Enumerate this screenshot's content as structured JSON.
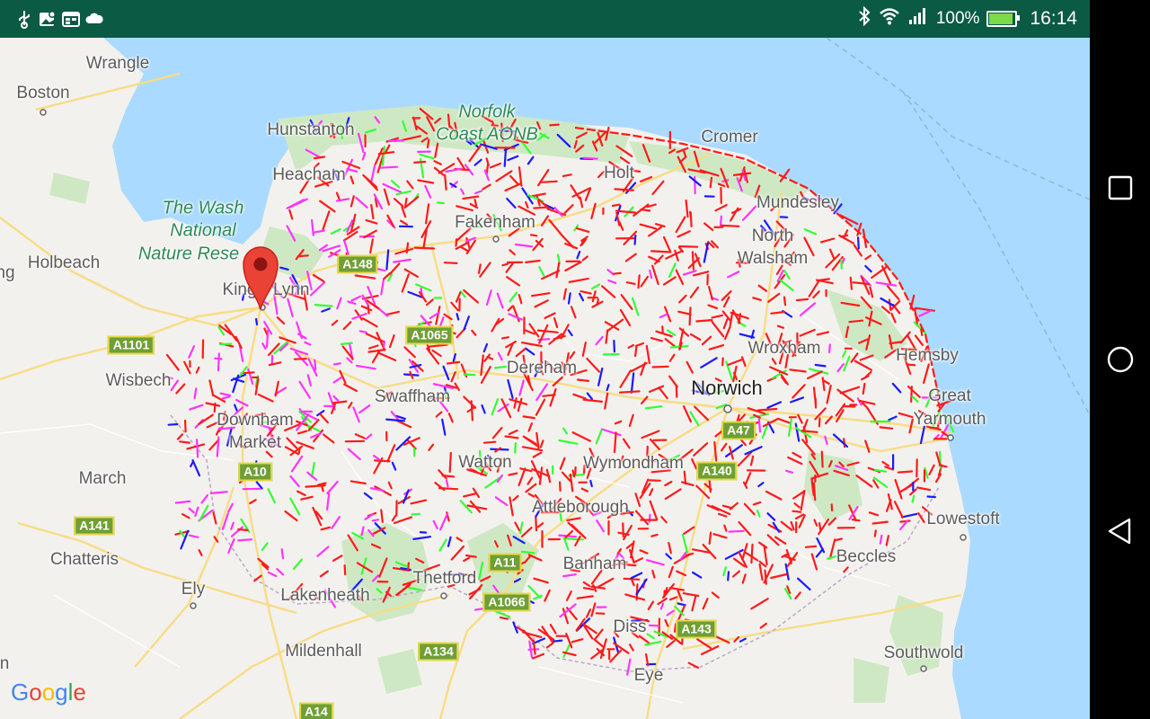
{
  "status_bar": {
    "battery_percent": "100%",
    "time": "16:14",
    "battery_level": 1.0,
    "icons": [
      "usb-icon",
      "location-image-icon",
      "calendar-icon",
      "cloud-icon",
      "bluetooth-icon",
      "wifi-icon",
      "signal-icon",
      "battery-charging-icon"
    ]
  },
  "map": {
    "places": [
      {
        "name": "Wrangle",
        "style": "town"
      },
      {
        "name": "Boston",
        "style": "city"
      },
      {
        "name": "Hunstanton",
        "style": "town"
      },
      {
        "name": "Heacham",
        "style": "town"
      },
      {
        "name": "Holt",
        "style": "town"
      },
      {
        "name": "Cromer",
        "style": "town"
      },
      {
        "name": "Mundesley",
        "style": "town"
      },
      {
        "name": "Fakenham",
        "style": "town"
      },
      {
        "name": "North",
        "style": "town"
      },
      {
        "name": "Walsham",
        "style": "town"
      },
      {
        "name": "Holbeach",
        "style": "town"
      },
      {
        "name": "King's Lynn",
        "style": "town"
      },
      {
        "name": "Wroxham",
        "style": "town"
      },
      {
        "name": "Hemsby",
        "style": "town"
      },
      {
        "name": "Dereham",
        "style": "town"
      },
      {
        "name": "Norwich",
        "style": "city"
      },
      {
        "name": "Wisbech",
        "style": "town"
      },
      {
        "name": "Swaffham",
        "style": "town"
      },
      {
        "name": "Great",
        "style": "town"
      },
      {
        "name": "Yarmouth",
        "style": "town"
      },
      {
        "name": "Downham",
        "style": "town"
      },
      {
        "name": "Market",
        "style": "town"
      },
      {
        "name": "Watton",
        "style": "town"
      },
      {
        "name": "Wymondham",
        "style": "town"
      },
      {
        "name": "March",
        "style": "town"
      },
      {
        "name": "Attleborough",
        "style": "town"
      },
      {
        "name": "Lowestoft",
        "style": "town"
      },
      {
        "name": "Chatteris",
        "style": "town"
      },
      {
        "name": "Banham",
        "style": "town"
      },
      {
        "name": "Beccles",
        "style": "town"
      },
      {
        "name": "Thetford",
        "style": "town"
      },
      {
        "name": "Ely",
        "style": "town"
      },
      {
        "name": "Lakenheath",
        "style": "town"
      },
      {
        "name": "Diss",
        "style": "town"
      },
      {
        "name": "Mildenhall",
        "style": "town"
      },
      {
        "name": "Southwold",
        "style": "town"
      },
      {
        "name": "Eye",
        "style": "town"
      },
      {
        "name": "ng",
        "style": "town"
      },
      {
        "name": "n",
        "style": "town"
      }
    ],
    "park_labels": [
      {
        "lines": [
          "Norfolk",
          "Coast AONB"
        ]
      },
      {
        "lines": [
          "The Wash",
          "National",
          "Nature Rese"
        ]
      }
    ],
    "road_shields": [
      "A148",
      "A1065",
      "A1101",
      "A10",
      "A47",
      "A140",
      "A141",
      "A11",
      "A1066",
      "A143",
      "A134",
      "A14"
    ],
    "marker": {
      "name": "dropped-pin",
      "place": "King's Lynn"
    },
    "overlay_colors": {
      "red": "#ff1a1a",
      "green": "#33ff33",
      "magenta": "#ff33ff",
      "blue": "#1a1aff"
    },
    "water_color": "#aadaff",
    "park_color": "#cfe8c4"
  },
  "attribution": {
    "logo": "Google"
  },
  "nav_bar": {
    "buttons": [
      "recent-apps",
      "home",
      "back"
    ]
  }
}
